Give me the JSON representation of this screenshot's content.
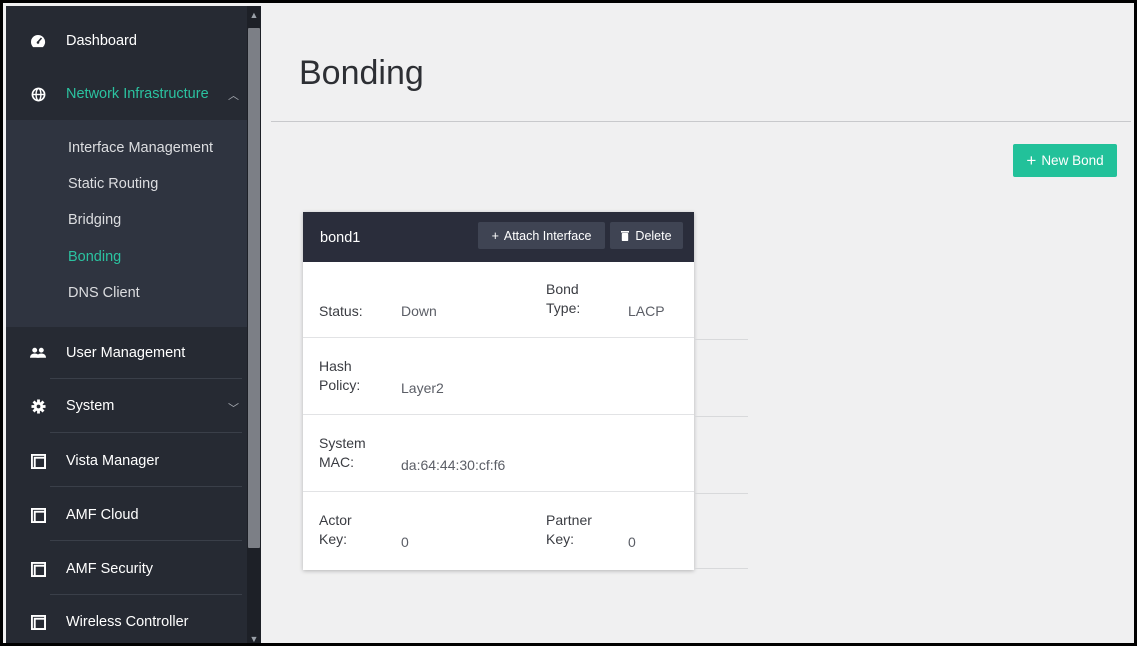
{
  "sidebar": {
    "items": [
      {
        "label": "Dashboard",
        "icon": "speedometer-icon"
      },
      {
        "label": "Network Infrastructure",
        "icon": "globe-icon"
      },
      {
        "label": "User Management",
        "icon": "users-icon"
      },
      {
        "label": "System",
        "icon": "gear-icon"
      },
      {
        "label": "Vista Manager",
        "icon": "window-icon"
      },
      {
        "label": "AMF Cloud",
        "icon": "window-icon"
      },
      {
        "label": "AMF Security",
        "icon": "window-icon"
      },
      {
        "label": "Wireless Controller",
        "icon": "window-icon"
      }
    ],
    "subitems": [
      "Interface Management",
      "Static Routing",
      "Bridging",
      "Bonding",
      "DNS Client"
    ],
    "active_sub": "Bonding"
  },
  "page": {
    "title": "Bonding",
    "new_bond_label": "New Bond"
  },
  "bond": {
    "name": "bond1",
    "attach_label": "Attach Interface",
    "delete_label": "Delete",
    "status_label": "Status:",
    "status_value": "Down",
    "bond_type_label_1": "Bond",
    "bond_type_label_2": "Type:",
    "bond_type_value": "LACP",
    "hash_label_1": "Hash",
    "hash_label_2": "Policy:",
    "hash_value": "Layer2",
    "mac_label_1": "System",
    "mac_label_2": "MAC:",
    "mac_value": "da:64:44:30:cf:f6",
    "actor_label_1": "Actor",
    "actor_label_2": "Key:",
    "actor_value": "0",
    "partner_label_1": "Partner",
    "partner_label_2": "Key:",
    "partner_value": "0"
  },
  "colors": {
    "accent": "#22c19a",
    "sidebar_bg": "#262a33",
    "card_header": "#2a2d3b"
  }
}
